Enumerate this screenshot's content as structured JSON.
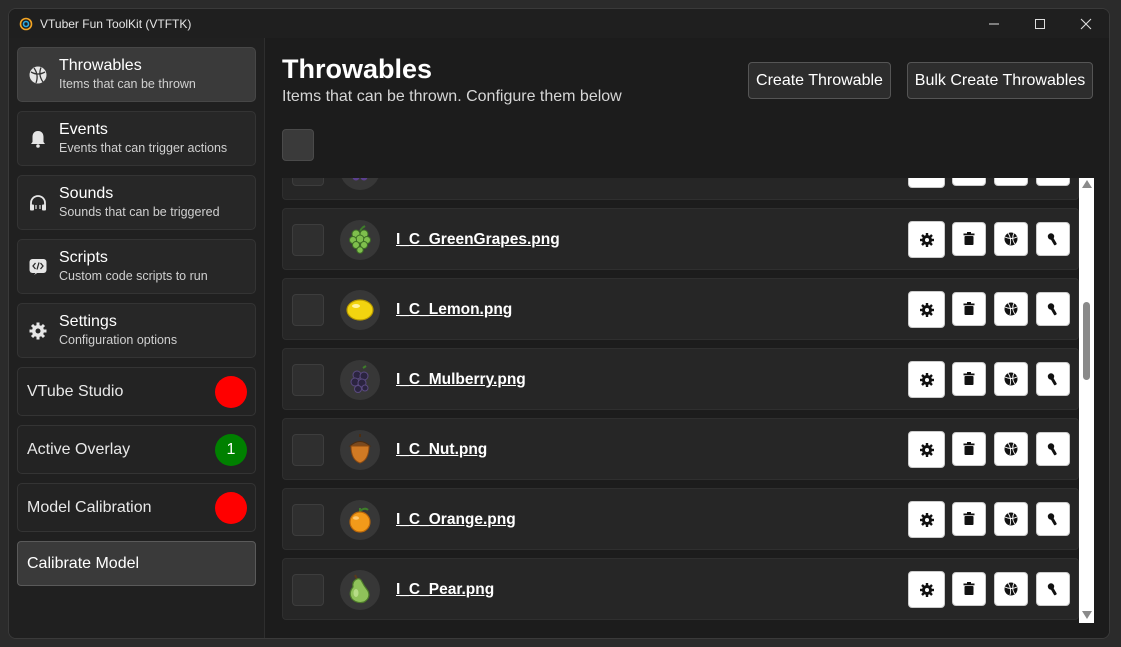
{
  "window": {
    "title": "VTuber Fun ToolKit (VTFTK)"
  },
  "sidebar": {
    "nav": [
      {
        "title": "Throwables",
        "subtitle": "Items that can be thrown",
        "icon": "ball-icon",
        "active": true
      },
      {
        "title": "Events",
        "subtitle": "Events that can trigger actions",
        "icon": "bell-icon",
        "active": false
      },
      {
        "title": "Sounds",
        "subtitle": "Sounds that can be triggered",
        "icon": "headphones-icon",
        "active": false
      },
      {
        "title": "Scripts",
        "subtitle": "Custom code scripts to run",
        "icon": "code-icon",
        "active": false
      },
      {
        "title": "Settings",
        "subtitle": "Configuration options",
        "icon": "gear-icon",
        "active": false
      }
    ],
    "status": [
      {
        "label": "VTube Studio",
        "value": "",
        "color": "#ff0000"
      },
      {
        "label": "Active Overlay",
        "value": "1",
        "color": "#008000"
      },
      {
        "label": "Model Calibration",
        "value": "",
        "color": "#ff0000"
      }
    ],
    "calibrate_label": "Calibrate Model"
  },
  "main": {
    "title": "Throwables",
    "subtitle": "Items that can be thrown. Configure them below",
    "create_label": "Create Throwable",
    "bulk_label": "Bulk Create Throwables",
    "items": [
      {
        "name": "",
        "icon": "grapes-icon"
      },
      {
        "name": "I_C_GreenGrapes.png",
        "icon": "green-grapes-icon"
      },
      {
        "name": "I_C_Lemon.png",
        "icon": "lemon-icon"
      },
      {
        "name": "I_C_Mulberry.png",
        "icon": "mulberry-icon"
      },
      {
        "name": "I_C_Nut.png",
        "icon": "nut-icon"
      },
      {
        "name": "I_C_Orange.png",
        "icon": "orange-icon"
      },
      {
        "name": "I_C_Pear.png",
        "icon": "pear-icon"
      }
    ]
  }
}
